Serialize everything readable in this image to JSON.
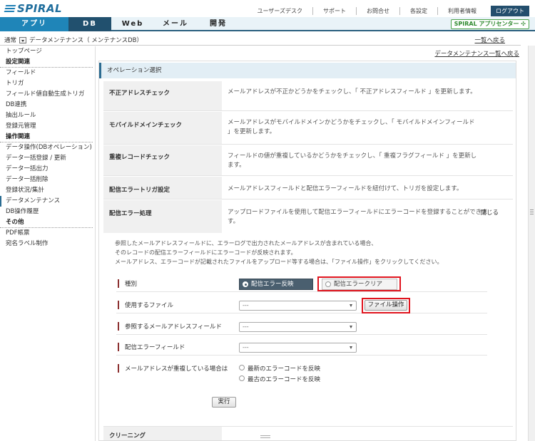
{
  "brand": {
    "logo_text": "SPIRAL"
  },
  "top_links": [
    "ユーザーズデスク",
    "サポート",
    "お問合せ",
    "各設定",
    "利用者情報"
  ],
  "logout_label": "ログアウト",
  "nav": {
    "tabs": [
      "アプリ",
      "DB",
      "Web",
      "メール",
      "開発"
    ],
    "active": "DB",
    "app_center": "SPIRAL アプリセンター"
  },
  "breadcrumb": {
    "mode": "通常",
    "text": "データメンテナンス（ メンテナンスDB）"
  },
  "back_to_list": "一覧へ戻る",
  "back_to_maint_list": "データメンテナンス一覧へ戻る",
  "sidebar": {
    "top": "トップページ",
    "groups": [
      {
        "title": "設定関連",
        "items": [
          "フィールド",
          "トリガ",
          "フィールド値自動生成トリガ",
          "DB連携",
          "抽出ルール",
          "登録元管理"
        ]
      },
      {
        "title": "操作関連",
        "items": [
          "データ操作(DBオペレーション)",
          "データ一括登録 / 更新",
          "データ一括出力",
          "データ一括削除",
          "登録状況/集計",
          "データメンテナンス",
          "DB操作履歴"
        ]
      },
      {
        "title": "その他",
        "items": [
          "PDF帳票",
          "宛名ラベル制作"
        ]
      }
    ],
    "active": "データメンテナンス"
  },
  "operations": {
    "title": "オペレーション選択",
    "rows": [
      {
        "label": "不正アドレスチェック",
        "desc": "メールアドレスが不正かどうかをチェックし、「 不正アドレスフィールド 」を更新します。"
      },
      {
        "label": "モバイルドメインチェック",
        "desc": "メールアドレスがモバイルドメインかどうかをチェックし、「 モバイルドメインフィールド 」を更新します。"
      },
      {
        "label": "重複レコードチェック",
        "desc": "フィールドの値が重複しているかどうかをチェックし、「 重複フラグフィールド 」を更新します。"
      },
      {
        "label": "配信エラートリガ設定",
        "desc": "メールアドレスフィールドと配信エラーフィールドを紐付けて、トリガを設定します。"
      },
      {
        "label": "配信エラー処理",
        "desc": "アップロードファイルを使用して配信エラーフィールドにエラーコードを登録することができます。"
      }
    ],
    "close_label": "閉じる",
    "detail_lines": [
      "参照したメールアドレスフィールドに、エラーログで出力されたメールアドレスが含まれている場合、",
      "そのレコードの配信エラーフィールドにエラーコードが反映されます。",
      "メールアドレス、エラーコードが記載されたファイルをアップロード等する場合は、「ファイル操作」をクリックしてください。"
    ],
    "form": {
      "type_label": "種別",
      "type_options": [
        "配信エラー反映",
        "配信エラークリア"
      ],
      "type_selected": "配信エラー反映",
      "file_label": "使用するファイル",
      "file_value": "---",
      "file_button": "ファイル操作",
      "email_field_label": "参照するメールアドレスフィールド",
      "email_field_value": "---",
      "error_field_label": "配信エラーフィールド",
      "error_field_value": "---",
      "dup_label": "メールアドレスが重複している場合は",
      "dup_options": [
        "最新のエラーコードを反映",
        "最古のエラーコードを反映"
      ],
      "run_label": "実行"
    },
    "next_row_label": "クリーニング"
  },
  "colors": {
    "accent": "#1f85b8",
    "dark": "#21506e",
    "highlight": "#e0141e"
  }
}
